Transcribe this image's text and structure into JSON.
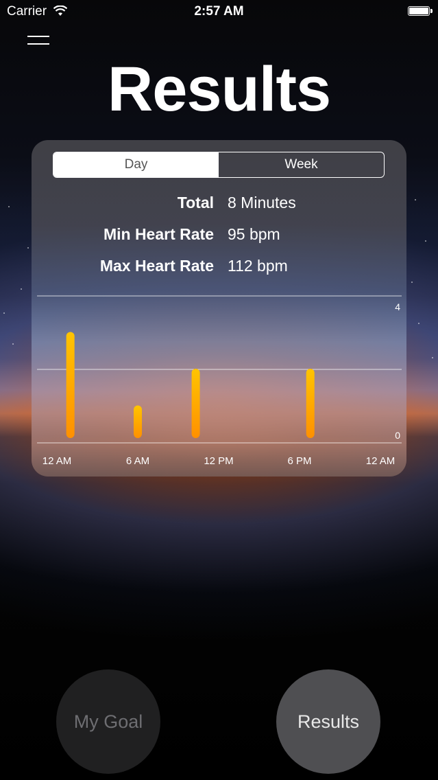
{
  "status_bar": {
    "carrier": "Carrier",
    "time": "2:57 AM"
  },
  "page": {
    "title": "Results"
  },
  "segments": [
    "Day",
    "Week"
  ],
  "selected_segment": "Day",
  "stats": [
    {
      "label": "Total",
      "value": "8 Minutes"
    },
    {
      "label": "Min Heart Rate",
      "value": "95 bpm"
    },
    {
      "label": "Max Heart Rate",
      "value": "112 bpm"
    }
  ],
  "chart_data": {
    "type": "bar",
    "title": "",
    "xlabel": "",
    "ylabel": "",
    "ylim": [
      0,
      4
    ],
    "y_ticks": [
      "4",
      "0"
    ],
    "x_ticks": [
      "12 AM",
      "6 AM",
      "12 PM",
      "6 PM",
      "12 AM"
    ],
    "x_range_hours": [
      0,
      24
    ],
    "points": [
      {
        "hour": 1,
        "value": 3
      },
      {
        "hour": 6,
        "value": 1
      },
      {
        "hour": 10.3,
        "value": 2
      },
      {
        "hour": 18.8,
        "value": 2
      }
    ],
    "bar_color": "#ffa500",
    "grid": true
  },
  "bottom_buttons": {
    "goal_label": "My Goal",
    "results_label": "Results"
  }
}
